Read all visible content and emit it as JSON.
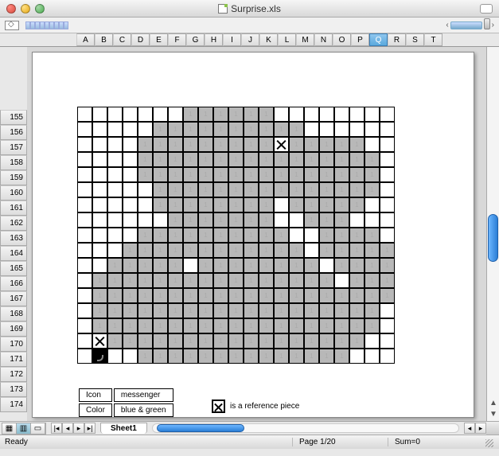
{
  "window": {
    "title": "Surprise.xls"
  },
  "columns": [
    "A",
    "B",
    "C",
    "D",
    "E",
    "F",
    "G",
    "H",
    "I",
    "J",
    "K",
    "L",
    "M",
    "N",
    "O",
    "P",
    "Q",
    "R",
    "S",
    "T"
  ],
  "selected_col": "Q",
  "rows": [
    155,
    156,
    157,
    158,
    159,
    160,
    161,
    162,
    163,
    164,
    165,
    166,
    167,
    168,
    169,
    170,
    171,
    172,
    173,
    174
  ],
  "sheet_tab": "Sheet1",
  "status": {
    "ready": "Ready",
    "page": "Page 1/20",
    "sum": "Sum=0"
  },
  "legend": {
    "icon_label": "Icon",
    "icon_value": "messenger",
    "color_label": "Color",
    "color_value": "blue & green",
    "ref_text": "is a reference piece"
  },
  "chart_data": {
    "type": "grid-pixel-art",
    "note": "21 cols x 17 rows; 0=empty white, 1=grey filled, 2=X reference marker, 3=black cursor cell",
    "cols": 21,
    "rows_count": 17,
    "cells": [
      [
        0,
        0,
        0,
        0,
        0,
        0,
        0,
        1,
        1,
        1,
        1,
        1,
        1,
        0,
        0,
        0,
        0,
        0,
        0,
        0,
        0
      ],
      [
        0,
        0,
        0,
        0,
        0,
        1,
        1,
        1,
        1,
        1,
        1,
        1,
        1,
        1,
        1,
        0,
        0,
        0,
        0,
        0,
        0
      ],
      [
        0,
        0,
        0,
        0,
        1,
        1,
        1,
        1,
        1,
        1,
        1,
        1,
        1,
        2,
        1,
        1,
        1,
        1,
        1,
        0,
        0
      ],
      [
        0,
        0,
        0,
        0,
        1,
        1,
        1,
        1,
        1,
        1,
        1,
        1,
        1,
        1,
        1,
        1,
        1,
        1,
        1,
        1,
        0
      ],
      [
        0,
        0,
        0,
        0,
        1,
        1,
        1,
        1,
        1,
        1,
        1,
        1,
        1,
        1,
        1,
        1,
        1,
        1,
        1,
        1,
        0
      ],
      [
        0,
        0,
        0,
        0,
        0,
        1,
        1,
        1,
        1,
        1,
        1,
        1,
        1,
        1,
        1,
        1,
        1,
        1,
        1,
        1,
        0
      ],
      [
        0,
        0,
        0,
        0,
        0,
        1,
        1,
        1,
        1,
        1,
        1,
        1,
        1,
        0,
        1,
        1,
        1,
        1,
        1,
        0,
        0
      ],
      [
        0,
        0,
        0,
        0,
        0,
        0,
        1,
        1,
        1,
        1,
        1,
        1,
        1,
        0,
        0,
        1,
        1,
        1,
        0,
        0,
        0
      ],
      [
        0,
        0,
        0,
        0,
        1,
        1,
        1,
        1,
        1,
        1,
        1,
        1,
        1,
        1,
        0,
        0,
        1,
        1,
        1,
        1,
        0
      ],
      [
        0,
        0,
        0,
        1,
        1,
        1,
        1,
        1,
        1,
        1,
        1,
        1,
        1,
        1,
        1,
        0,
        1,
        1,
        1,
        1,
        1
      ],
      [
        0,
        0,
        1,
        1,
        1,
        1,
        1,
        0,
        1,
        1,
        1,
        1,
        1,
        1,
        1,
        1,
        0,
        1,
        1,
        1,
        1
      ],
      [
        0,
        1,
        1,
        1,
        1,
        1,
        1,
        1,
        1,
        1,
        1,
        1,
        1,
        1,
        1,
        1,
        1,
        0,
        1,
        1,
        1
      ],
      [
        0,
        1,
        1,
        1,
        1,
        1,
        1,
        1,
        1,
        1,
        1,
        1,
        1,
        1,
        1,
        1,
        1,
        1,
        1,
        1,
        1
      ],
      [
        0,
        1,
        1,
        1,
        1,
        1,
        1,
        1,
        1,
        1,
        1,
        1,
        1,
        1,
        1,
        1,
        1,
        1,
        1,
        1,
        0
      ],
      [
        0,
        1,
        1,
        1,
        1,
        1,
        1,
        1,
        1,
        1,
        1,
        1,
        1,
        1,
        1,
        1,
        1,
        1,
        1,
        1,
        0
      ],
      [
        0,
        2,
        1,
        1,
        1,
        1,
        1,
        1,
        1,
        1,
        1,
        1,
        1,
        1,
        1,
        1,
        1,
        1,
        1,
        0,
        0
      ],
      [
        0,
        3,
        0,
        0,
        1,
        1,
        1,
        1,
        1,
        1,
        1,
        1,
        1,
        1,
        1,
        1,
        1,
        1,
        0,
        0,
        0
      ]
    ]
  }
}
